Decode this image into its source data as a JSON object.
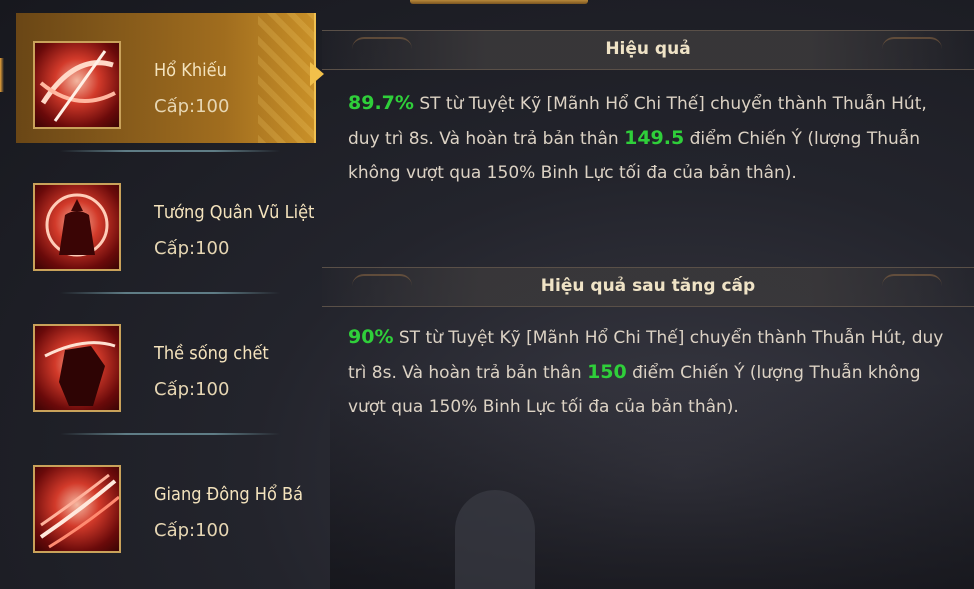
{
  "skills": [
    {
      "name": "Hổ Khiếu",
      "level": "Cấp:100",
      "icon": "tiger-slash-icon",
      "selected": true
    },
    {
      "name": "Tướng Quân Vũ Liệt",
      "level": "Cấp:100",
      "icon": "general-silhouette-icon",
      "selected": false
    },
    {
      "name": "Thề sống chết",
      "level": "Cấp:100",
      "icon": "warrior-charge-icon",
      "selected": false
    },
    {
      "name": "Giang Đông Hổ Bá",
      "level": "Cấp:100",
      "icon": "red-claw-strike-icon",
      "selected": false
    }
  ],
  "effect": {
    "title": "Hiệu quả",
    "highlight1": "89.7%",
    "text1": " ST từ Tuyệt Kỹ [Mãnh Hổ Chi Thế] chuyển thành Thuẫn Hút, duy trì 8s. Và hoàn trả bản thân ",
    "highlight2": "149.5",
    "text2": " điểm Chiến Ý (lượng Thuẫn không vượt qua 150% Binh Lực tối đa của bản thân)."
  },
  "upgrade": {
    "title": "Hiệu quả sau tăng cấp",
    "highlight1": "90%",
    "text1": " ST từ Tuyệt Kỹ [Mãnh Hổ Chi Thế] chuyển thành Thuẫn Hút, duy trì 8s. Và hoàn trả bản thân ",
    "highlight2": "150",
    "text2": " điểm Chiến Ý (lượng Thuẫn không vượt qua 150% Binh Lực tối đa của bản thân)."
  },
  "colors": {
    "highlight": "#2fcf3a",
    "selected_gold": "#f0c050",
    "text": "#dcd2c4"
  }
}
